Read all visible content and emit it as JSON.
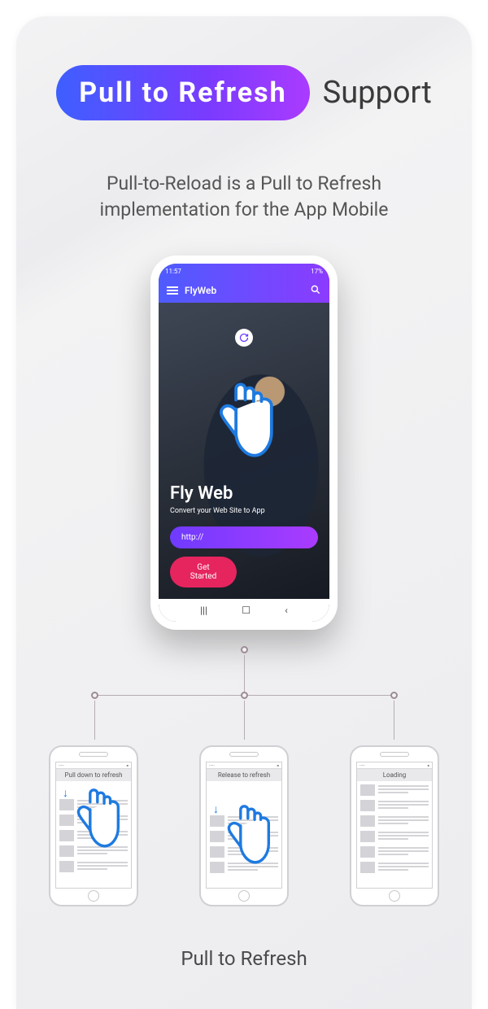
{
  "title": {
    "pill": "Pull to Refresh",
    "support": "Support"
  },
  "subtitle": "Pull-to-Reload is a Pull to Refresh implementation for the App Mobile",
  "phone": {
    "status_time": "11:57",
    "status_right": "17%",
    "app_name": "FlyWeb",
    "hero_title": "Fly Web",
    "hero_subtitle": "Convert your Web Site to App",
    "url_placeholder": "http://",
    "get_started": "Get Started",
    "nav": {
      "recent": "|||",
      "home": "☐",
      "back": "‹"
    }
  },
  "states": {
    "pull": "Pull down to refresh",
    "release": "Release to refresh",
    "loading": "Loading"
  },
  "caption": "Pull to Refresh"
}
